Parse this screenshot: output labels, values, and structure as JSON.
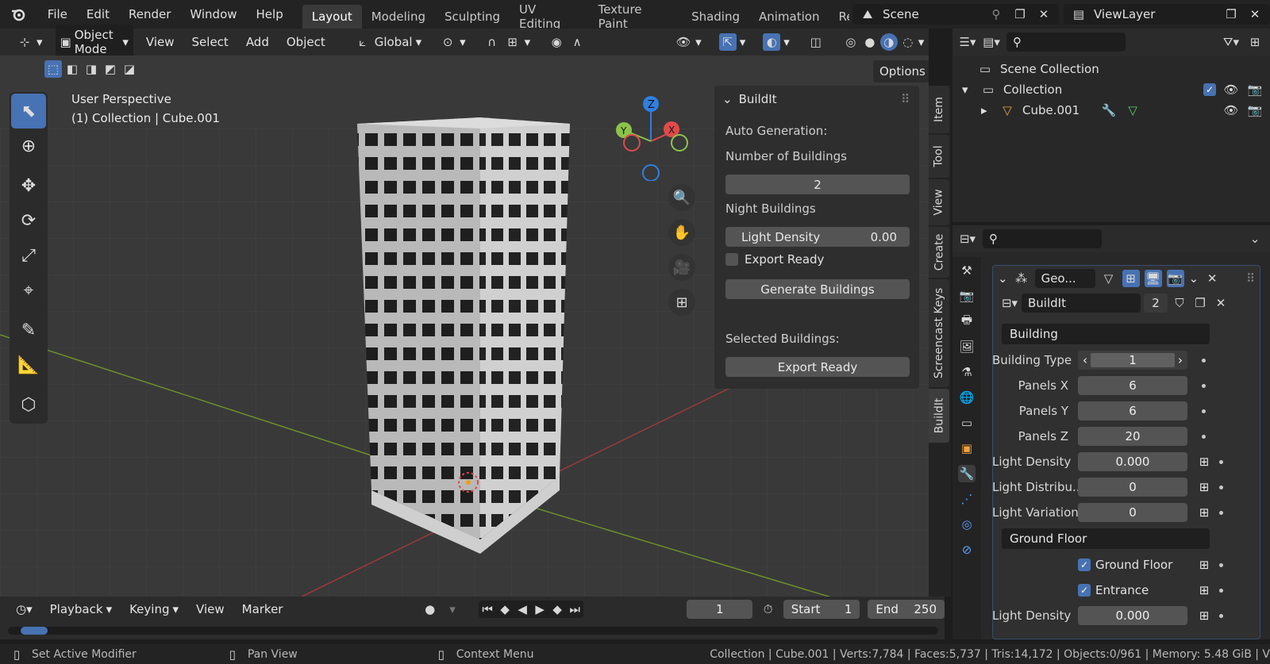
{
  "topbar": {
    "menus": [
      "File",
      "Edit",
      "Render",
      "Window",
      "Help"
    ],
    "workspaces": [
      "Layout",
      "Modeling",
      "Sculpting",
      "UV Editing",
      "Texture Paint",
      "Shading",
      "Animation",
      "Re"
    ],
    "active_workspace": "Layout",
    "scene": "Scene",
    "view_layer": "ViewLayer"
  },
  "viewport_header": {
    "mode": "Object Mode",
    "menus": [
      "View",
      "Select",
      "Add",
      "Object"
    ],
    "orientation": "Global",
    "options": "Options"
  },
  "viewport": {
    "perspective": "User Perspective",
    "collection_info": "(1) Collection | Cube.001",
    "gizmo": {
      "z": "Z",
      "y": "Y",
      "x": "X"
    }
  },
  "npanel": {
    "title": "BuildIt",
    "auto_generation": "Auto Generation:",
    "num_buildings_label": "Number of Buildings",
    "num_buildings_value": "2",
    "night_buildings": "Night Buildings",
    "light_density_label": "Light Density",
    "light_density_value": "0.00",
    "export_ready_checkbox": "Export Ready",
    "generate_button": "Generate Buildings",
    "selected_buildings": "Selected Buildings:",
    "export_ready_button": "Export Ready"
  },
  "side_tabs": [
    "Item",
    "Tool",
    "View",
    "Create",
    "Screencast Keys",
    "BuildIt"
  ],
  "outliner": {
    "scene_collection": "Scene Collection",
    "collection": "Collection",
    "object": "Cube.001"
  },
  "properties": {
    "modifier_name": "Geo...",
    "node_group": "BuildIt",
    "user_count": "2",
    "sections": {
      "building": "Building",
      "ground_floor": "Ground Floor"
    },
    "rows": [
      {
        "label": "Building Type",
        "value": "1"
      },
      {
        "label": "Panels X",
        "value": "6"
      },
      {
        "label": "Panels Y",
        "value": "6"
      },
      {
        "label": "Panels Z",
        "value": "20"
      },
      {
        "label": "Light Density",
        "value": "0.000"
      },
      {
        "label": "Light Distribu...",
        "value": "0"
      },
      {
        "label": "Light Variations",
        "value": "0"
      }
    ],
    "ground_rows": [
      {
        "label": "Ground Floor"
      },
      {
        "label": "Entrance"
      }
    ],
    "ground_light_density": {
      "label": "Light Density",
      "value": "0.000"
    }
  },
  "timeline": {
    "menus": [
      "Playback",
      "Keying",
      "View",
      "Marker"
    ],
    "current_frame": "1",
    "start_label": "Start",
    "start_value": "1",
    "end_label": "End",
    "end_value": "250"
  },
  "statusbar": {
    "left1": "Set Active Modifier",
    "left2": "Pan View",
    "left3": "Context Menu",
    "stats": "Collection | Cube.001 | Verts:7,784 | Faces:5,737 | Tris:14,172 | Objects:0/961 | Memory: 5.48 GiB | V"
  },
  "colors": {
    "accent": "#4772b3",
    "x_axis": "#e04a4a",
    "y_axis": "#8bc34a",
    "z_axis": "#2f7fe0"
  }
}
